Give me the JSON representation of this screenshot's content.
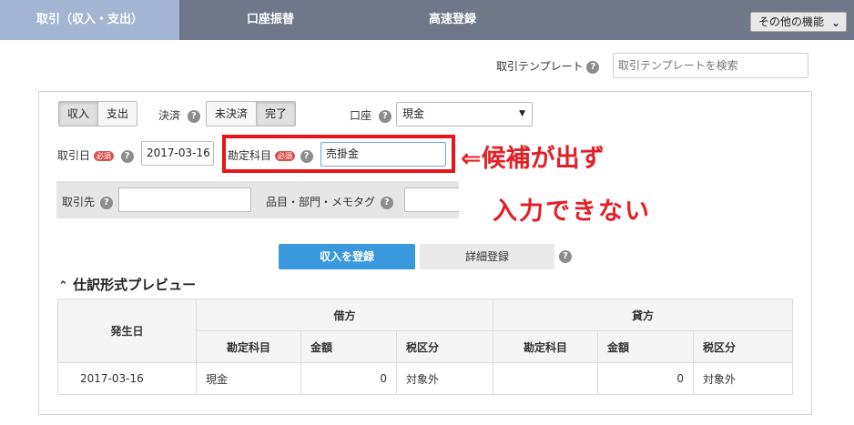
{
  "nav": {
    "tabs": [
      "取引（収入・支出）",
      "口座振替",
      "高速登録"
    ],
    "other": "その他の機能"
  },
  "template": {
    "label": "取引テンプレート",
    "placeholder": "取引テンプレートを検索"
  },
  "form": {
    "type": [
      "収入",
      "支出"
    ],
    "settle_label": "決済",
    "settle": [
      "未決済",
      "完了"
    ],
    "account_label": "口座",
    "account_value": "現金",
    "date_label": "取引日",
    "required": "必須",
    "date_value": "2017-03-16",
    "item_label": "勘定科目",
    "item_value": "売掛金",
    "partner_label": "取引先",
    "tags_label": "品目・部門・メモタグ"
  },
  "annotation": {
    "line1": "⇐候補が出ず",
    "line2": "入力できない"
  },
  "actions": {
    "register": "収入を登録",
    "detail": "詳細登録"
  },
  "preview": {
    "title": "仕訳形式プレビュー",
    "date_header": "発生日",
    "debit_header": "借方",
    "credit_header": "貸方",
    "sub_headers": [
      "勘定科目",
      "金額",
      "税区分",
      "勘定科目",
      "金額",
      "税区分"
    ],
    "row": {
      "date": "2017-03-16",
      "debit_account": "現金",
      "debit_amount": "0",
      "debit_tax": "対象外",
      "credit_account": "",
      "credit_amount": "0",
      "credit_tax": "対象外"
    }
  },
  "colors": {
    "nav_bg": "#707789",
    "active_tab": "#a3b5d3",
    "primary": "#3a98dd",
    "alert": "#e32027"
  }
}
